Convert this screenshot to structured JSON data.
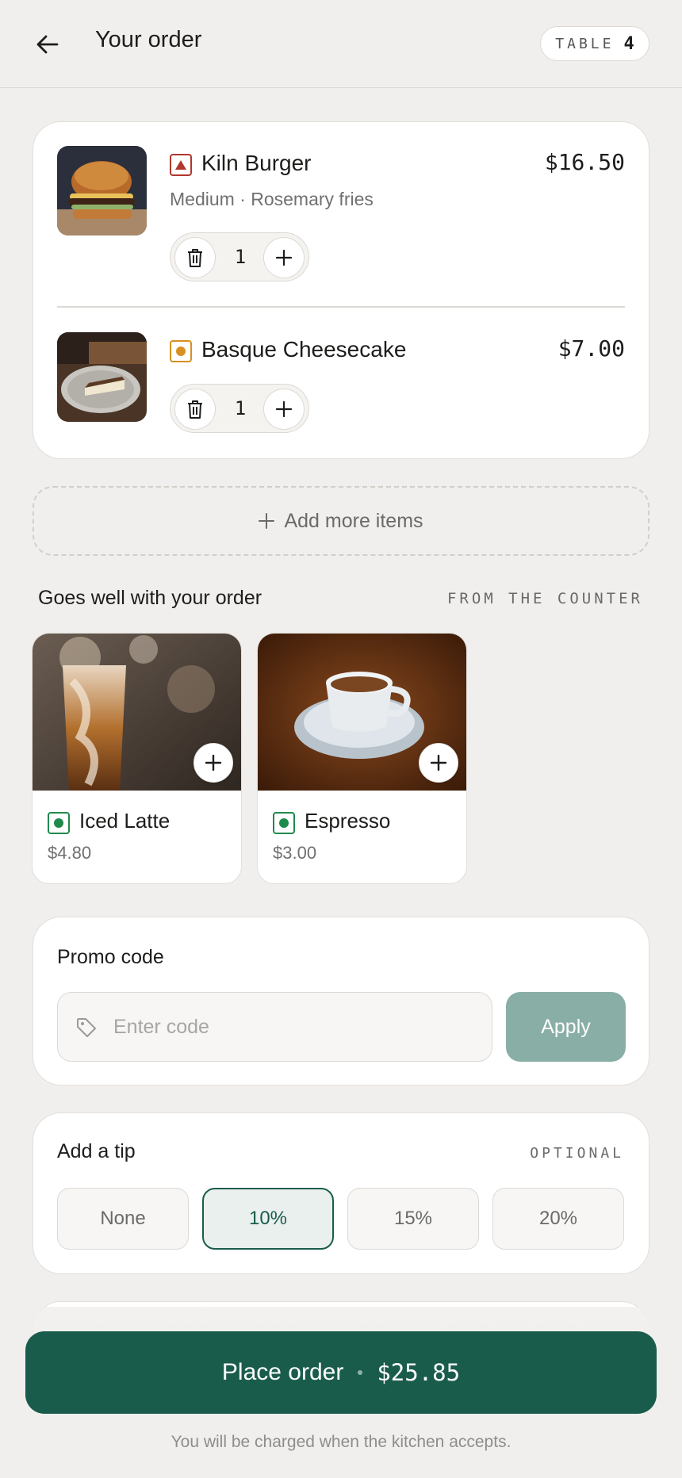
{
  "header": {
    "title": "Your order",
    "table_label": "TABLE",
    "table_number": "4"
  },
  "order": {
    "items": [
      {
        "name": "Kiln Burger",
        "description": "Medium · Rosemary fries",
        "price": "$16.50",
        "quantity": "1",
        "diet": "non-veg",
        "diet_color": "#b1372d"
      },
      {
        "name": "Basque Cheesecake",
        "description": "",
        "price": "$7.00",
        "quantity": "1",
        "diet": "egg",
        "diet_color": "#d89120"
      }
    ],
    "add_more_label": "Add more items"
  },
  "suggestions": {
    "title": "Goes well with your order",
    "tag": "FROM THE COUNTER",
    "items": [
      {
        "name": "Iced Latte",
        "price": "$4.80",
        "diet": "veg"
      },
      {
        "name": "Espresso",
        "price": "$3.00",
        "diet": "veg"
      }
    ]
  },
  "promo": {
    "title": "Promo code",
    "placeholder": "Enter code",
    "value": "",
    "apply_label": "Apply"
  },
  "tip": {
    "title": "Add a tip",
    "tag": "OPTIONAL",
    "options": [
      "None",
      "10%",
      "15%",
      "20%"
    ],
    "selected": "10%"
  },
  "footer": {
    "place_order_label": "Place order",
    "total": "$25.85",
    "note": "You will be charged when the kitchen accepts."
  },
  "colors": {
    "accent": "#1a5c4c",
    "apply_button": "#89aea5",
    "veg": "#1f8a4c",
    "non_veg": "#b1372d",
    "egg": "#d89120",
    "background": "#f1efed"
  },
  "icons": {
    "back": "arrow-left-icon",
    "delete": "trash-icon",
    "increment": "plus-icon",
    "promo": "tag-icon"
  }
}
